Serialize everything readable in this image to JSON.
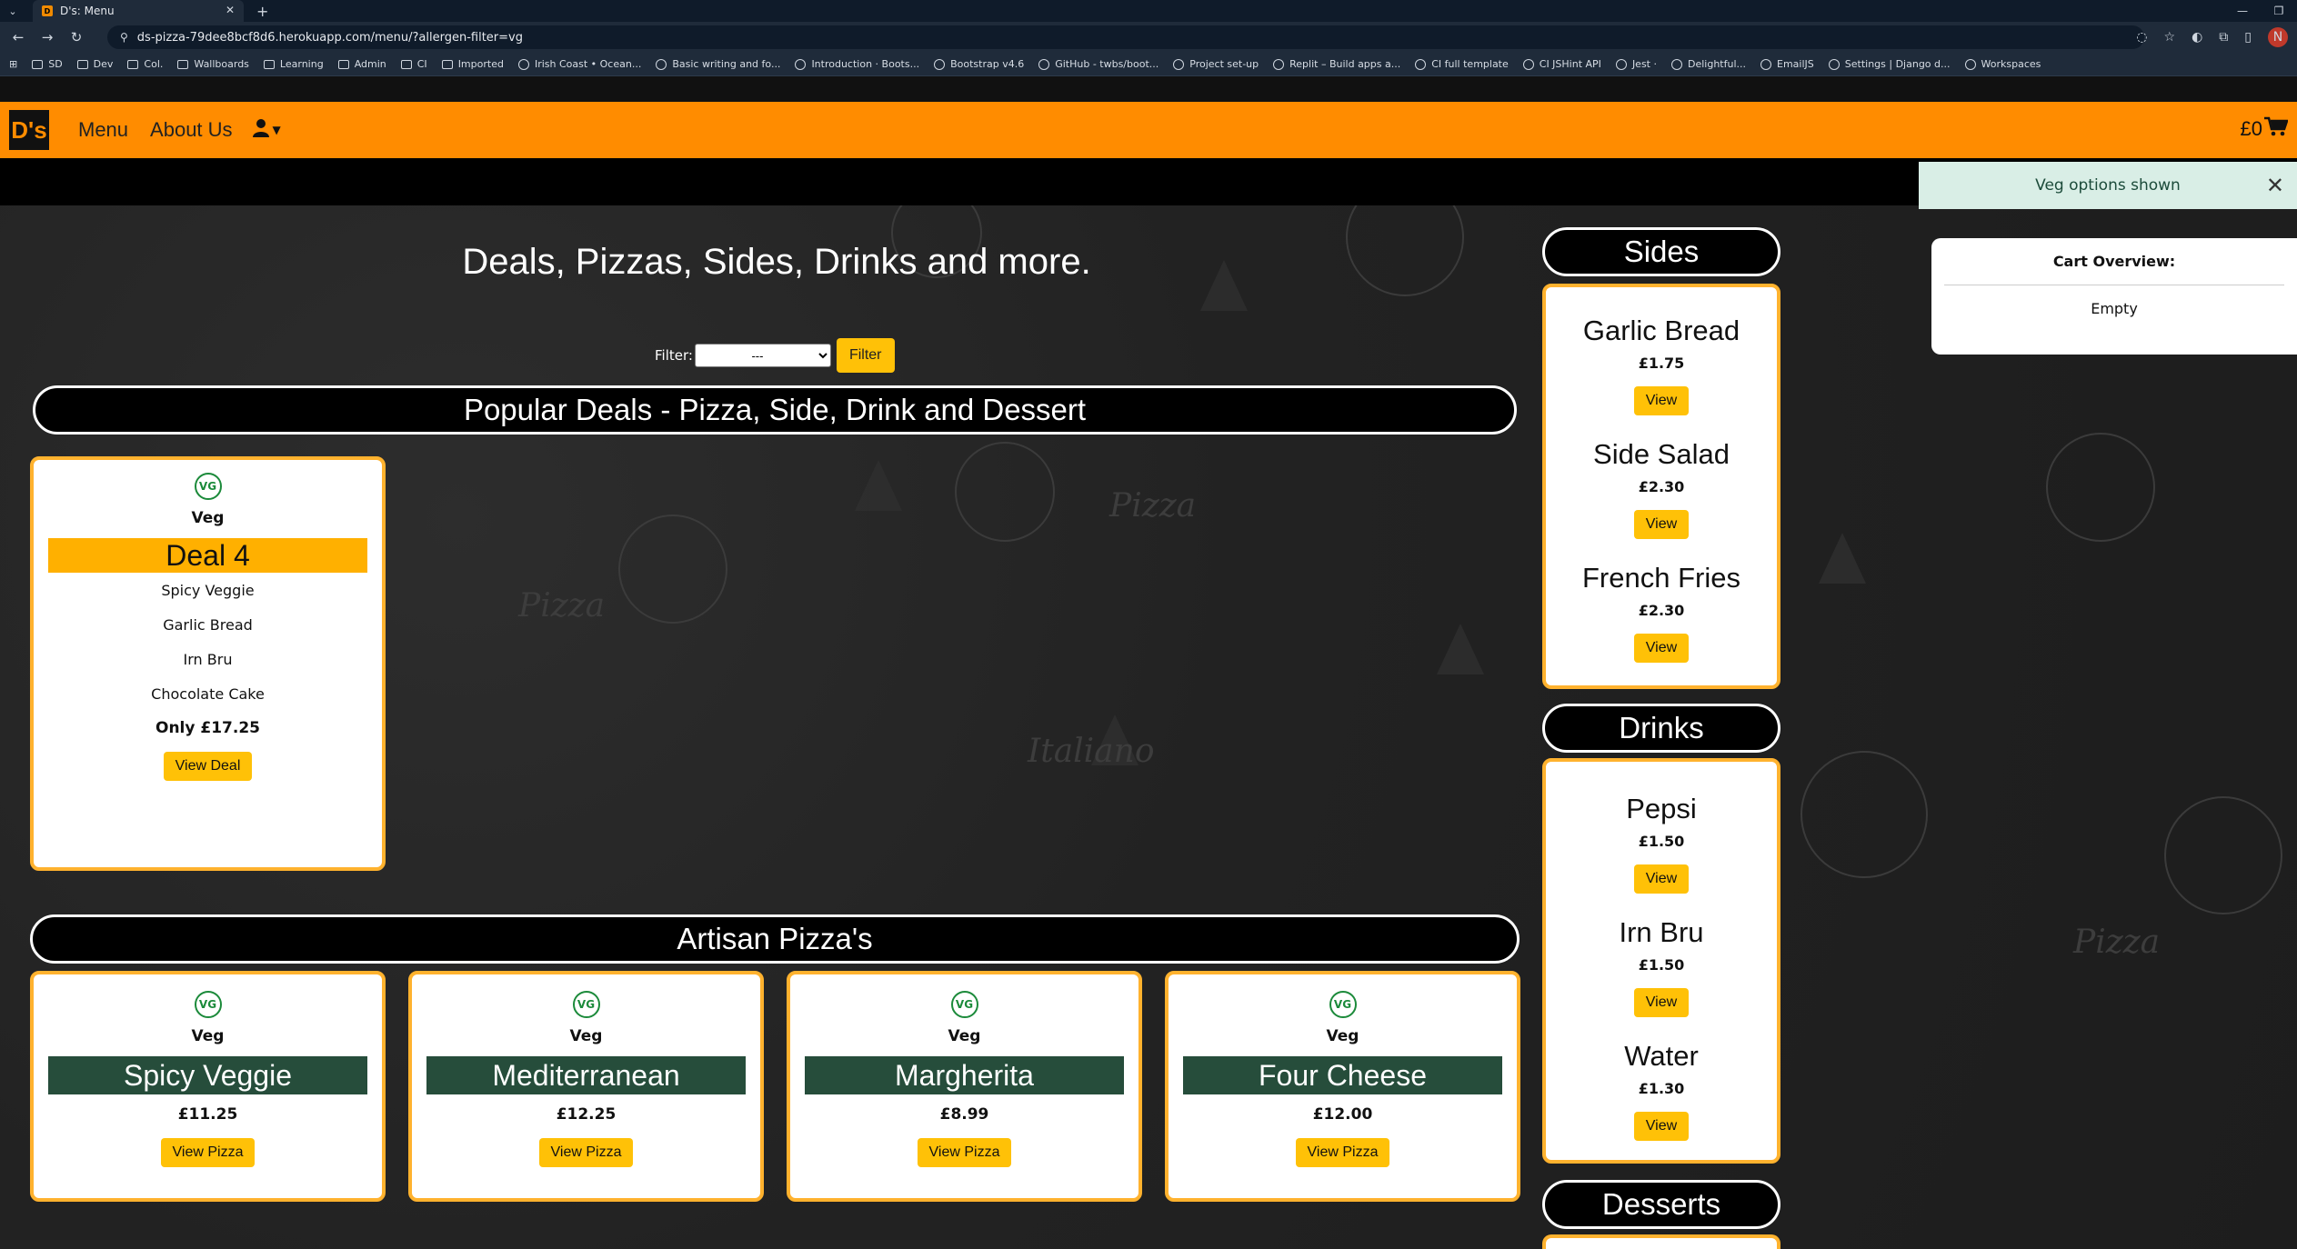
{
  "browser": {
    "tab_title": "D's: Menu",
    "tab_close": "✕",
    "new_tab": "+",
    "url": "ds-pizza-79dee8bcf8d6.herokuapp.com/menu/?allergen-filter=vg",
    "profile_initial": "N",
    "bookmarks": [
      "SD",
      "Dev",
      "Col.",
      "Wallboards",
      "Learning",
      "Admin",
      "CI",
      "Imported",
      "Irish Coast • Ocean...",
      "Basic writing and fo...",
      "Introduction · Boots...",
      "Bootstrap v4.6",
      "GitHub - twbs/boot...",
      "Project set-up",
      "Replit – Build apps a...",
      "CI full template",
      "CI JSHint API",
      "Jest ·",
      "Delightful...",
      "EmailJS",
      "Settings | Django d...",
      "Workspaces"
    ]
  },
  "navbar": {
    "brand": "D's",
    "links": [
      "Menu",
      "About Us"
    ],
    "cart_total": "£0"
  },
  "toast": {
    "message": "Veg options shown",
    "close": "✕"
  },
  "cart_overview": {
    "title": "Cart Overview:",
    "status": "Empty"
  },
  "page": {
    "heading": "Deals, Pizzas, Sides, Drinks and more.",
    "filter_label": "Filter:",
    "filter_selected": "---",
    "filter_button": "Filter"
  },
  "deals": {
    "section_title": "Popular Deals - Pizza, Side, Drink and Dessert",
    "items": [
      {
        "badge": "VG",
        "diet": "Veg",
        "name": "Deal 4",
        "contents": [
          "Spicy Veggie",
          "Garlic Bread",
          "Irn Bru",
          "Chocolate Cake"
        ],
        "price": "Only £17.25",
        "button": "View Deal"
      }
    ]
  },
  "pizzas": {
    "section_title": "Artisan Pizza's",
    "items": [
      {
        "badge": "VG",
        "diet": "Veg",
        "name": "Spicy Veggie",
        "price": "£11.25",
        "button": "View Pizza"
      },
      {
        "badge": "VG",
        "diet": "Veg",
        "name": "Mediterranean",
        "price": "£12.25",
        "button": "View Pizza"
      },
      {
        "badge": "VG",
        "diet": "Veg",
        "name": "Margherita",
        "price": "£8.99",
        "button": "View Pizza"
      },
      {
        "badge": "VG",
        "diet": "Veg",
        "name": "Four Cheese",
        "price": "£12.00",
        "button": "View Pizza"
      }
    ]
  },
  "sides": {
    "section_title": "Sides",
    "items": [
      {
        "name": "Garlic Bread",
        "price": "£1.75",
        "button": "View"
      },
      {
        "name": "Side Salad",
        "price": "£2.30",
        "button": "View"
      },
      {
        "name": "French Fries",
        "price": "£2.30",
        "button": "View"
      }
    ]
  },
  "drinks": {
    "section_title": "Drinks",
    "items": [
      {
        "name": "Pepsi",
        "price": "£1.50",
        "button": "View"
      },
      {
        "name": "Irn Bru",
        "price": "£1.50",
        "button": "View"
      },
      {
        "name": "Water",
        "price": "£1.30",
        "button": "View"
      }
    ]
  },
  "desserts": {
    "section_title": "Desserts"
  },
  "colors": {
    "navbar": "#ff8c00",
    "card_border": "#ffb22e",
    "button": "#ffc107",
    "pizza_title_bg": "#264d3b",
    "veg_badge": "#1b8a3a",
    "toast_bg": "#d9eee6"
  },
  "icons": [
    "tab-search-icon",
    "back-icon",
    "forward-icon",
    "reload-icon",
    "star-icon",
    "extensions-icon",
    "user-icon",
    "cart-icon",
    "close-icon",
    "veg-badge-icon"
  ]
}
